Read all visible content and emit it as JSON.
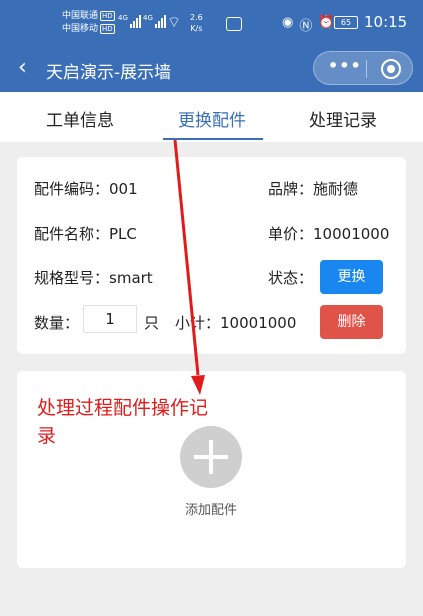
{
  "status_bar": {
    "carrier_1": "中国联通",
    "carrier_2": "中国移动",
    "hd_tag": "HD",
    "net_type": "4G",
    "speed_value": "2.6",
    "speed_unit": "K/s",
    "battery": "65",
    "time": "10:15"
  },
  "nav": {
    "title": "天启演示-展示墙",
    "back_icon": "chevron-left-icon",
    "more_icon": "more-dots-icon",
    "close_icon": "target-circle-icon",
    "color": "#3a6fb8"
  },
  "tabs": [
    {
      "label": "工单信息"
    },
    {
      "label": "更换配件",
      "active": true
    },
    {
      "label": "处理记录"
    }
  ],
  "part": {
    "code_label": "配件编码：",
    "code": "001",
    "brand_label": "品牌：",
    "brand": "施耐德",
    "name_label": "配件名称：",
    "name": "PLC",
    "price_label": "单价：",
    "price": "10001000",
    "model_label": "规格型号：",
    "model": "smart",
    "status_label": "状态：",
    "replace_button": "更换",
    "qty_label": "数量：",
    "qty": "1",
    "qty_unit": "只",
    "subtotal_label": "小计：",
    "subtotal": "10001000",
    "delete_button": "删除"
  },
  "record": {
    "add_label": "添加配件",
    "add_icon": "plus-circle-icon"
  },
  "annotation": {
    "text": "处理过程配件操作记录",
    "color": "#e11b1b"
  }
}
